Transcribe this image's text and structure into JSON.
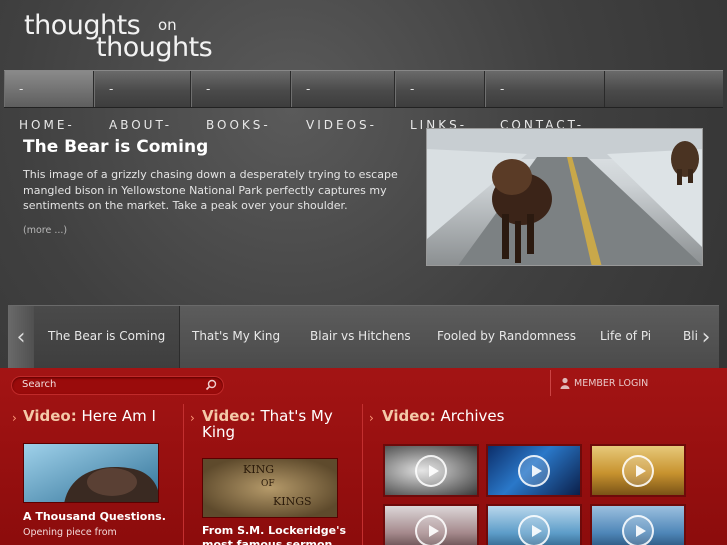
{
  "logo": {
    "line1": "thoughts",
    "line2": "on",
    "line3": "thoughts"
  },
  "nav": {
    "items": [
      "-HOME-",
      "-ABOUT-",
      "-BOOKS-",
      "-VIDEOS-",
      "-LINKS-",
      "-CONTACT-"
    ],
    "active_index": 0
  },
  "feature": {
    "title": "The Bear is Coming",
    "text": "This image of a grizzly chasing down a desperately trying to escape mangled bison in Yellowstone National Park perfectly captures my sentiments on the market.  Take a peak over your shoulder.",
    "more": "(more ...)",
    "image_desc_icon": "bison-bear-photo"
  },
  "slider": {
    "tabs": [
      "The Bear is Coming",
      "That's My King",
      "Blair vs Hitchens",
      "Fooled by Randomness",
      "Life of Pi",
      "Bli"
    ],
    "active_index": 0,
    "left_arrow": "‹",
    "right_arrow": "›"
  },
  "search": {
    "placeholder": "Search"
  },
  "member": {
    "label": "MEMBER LOGIN"
  },
  "columns": {
    "col1": {
      "kw": "Video:",
      "title": " Here Am I",
      "caption": "A Thousand Questions.",
      "sub": "Opening piece from"
    },
    "col2": {
      "kw": "Video:",
      "title": " That's My King",
      "thumb_text": [
        "KING",
        "OF",
        "KINGS"
      ],
      "caption": "From S.M. Lockeridge's most famous sermon"
    },
    "col3": {
      "kw": "Video:",
      "title": " Archives"
    }
  },
  "colors": {
    "red": "#a31414",
    "accent_kw": "#f4c9a8",
    "nav_bg": "#4a4a4a"
  }
}
